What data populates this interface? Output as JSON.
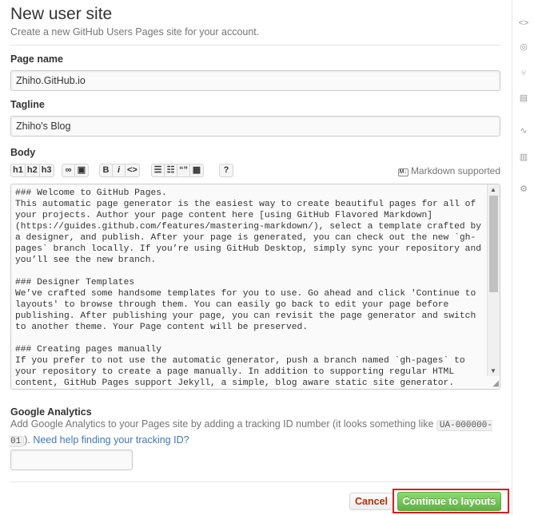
{
  "page": {
    "title": "New user site",
    "subtitle": "Create a new GitHub Users Pages site for your account."
  },
  "form": {
    "page_name_label": "Page name",
    "page_name_value": "Zhiho.GitHub.io",
    "tagline_label": "Tagline",
    "tagline_value": "Zhiho's Blog",
    "body_label": "Body",
    "markdown_hint": "Markdown supported",
    "toolbar": {
      "h1": "h1",
      "h2": "h2",
      "h3": "h3",
      "bold": "B",
      "italic": "i",
      "code": "<>",
      "quote": "“”"
    },
    "body_text": "### Welcome to GitHub Pages.\nThis automatic page generator is the easiest way to create beautiful pages for all of your projects. Author your page content here [using GitHub Flavored Markdown](https://guides.github.com/features/mastering-markdown/), select a template crafted by a designer, and publish. After your page is generated, you can check out the new `gh-pages` branch locally. If you’re using GitHub Desktop, simply sync your repository and you’ll see the new branch.\n\n### Designer Templates\nWe’ve crafted some handsome templates for you to use. Go ahead and click 'Continue to layouts' to browse through them. You can easily go back to edit your page before publishing. After publishing your page, you can revisit the page generator and switch to another theme. Your Page content will be preserved.\n\n### Creating pages manually\nIf you prefer to not use the automatic generator, push a branch named `gh-pages` to your repository to create a page manually. In addition to supporting regular HTML content, GitHub Pages support Jekyll, a simple, blog aware static site generator. Jekyll makes it",
    "ga_label": "Google Analytics",
    "ga_desc_prefix": "Add Google Analytics to your Pages site by adding a tracking ID number (it looks something like ",
    "ga_code_example": "UA-000000-01",
    "ga_desc_suffix": "). ",
    "ga_help_link": "Need help finding your tracking ID?",
    "ga_value": ""
  },
  "actions": {
    "cancel_label": "Cancel",
    "continue_label": "Continue to layouts"
  },
  "sidebar": {
    "icons": [
      "code-icon",
      "issue-icon",
      "pull-request-icon",
      "wiki-icon",
      "pulse-icon",
      "graph-icon",
      "settings-icon"
    ]
  },
  "colors": {
    "continue_green": "#60b044",
    "cancel_red": "#bd2c00",
    "highlight_red": "#d81e22",
    "link_blue": "#4078c0"
  }
}
